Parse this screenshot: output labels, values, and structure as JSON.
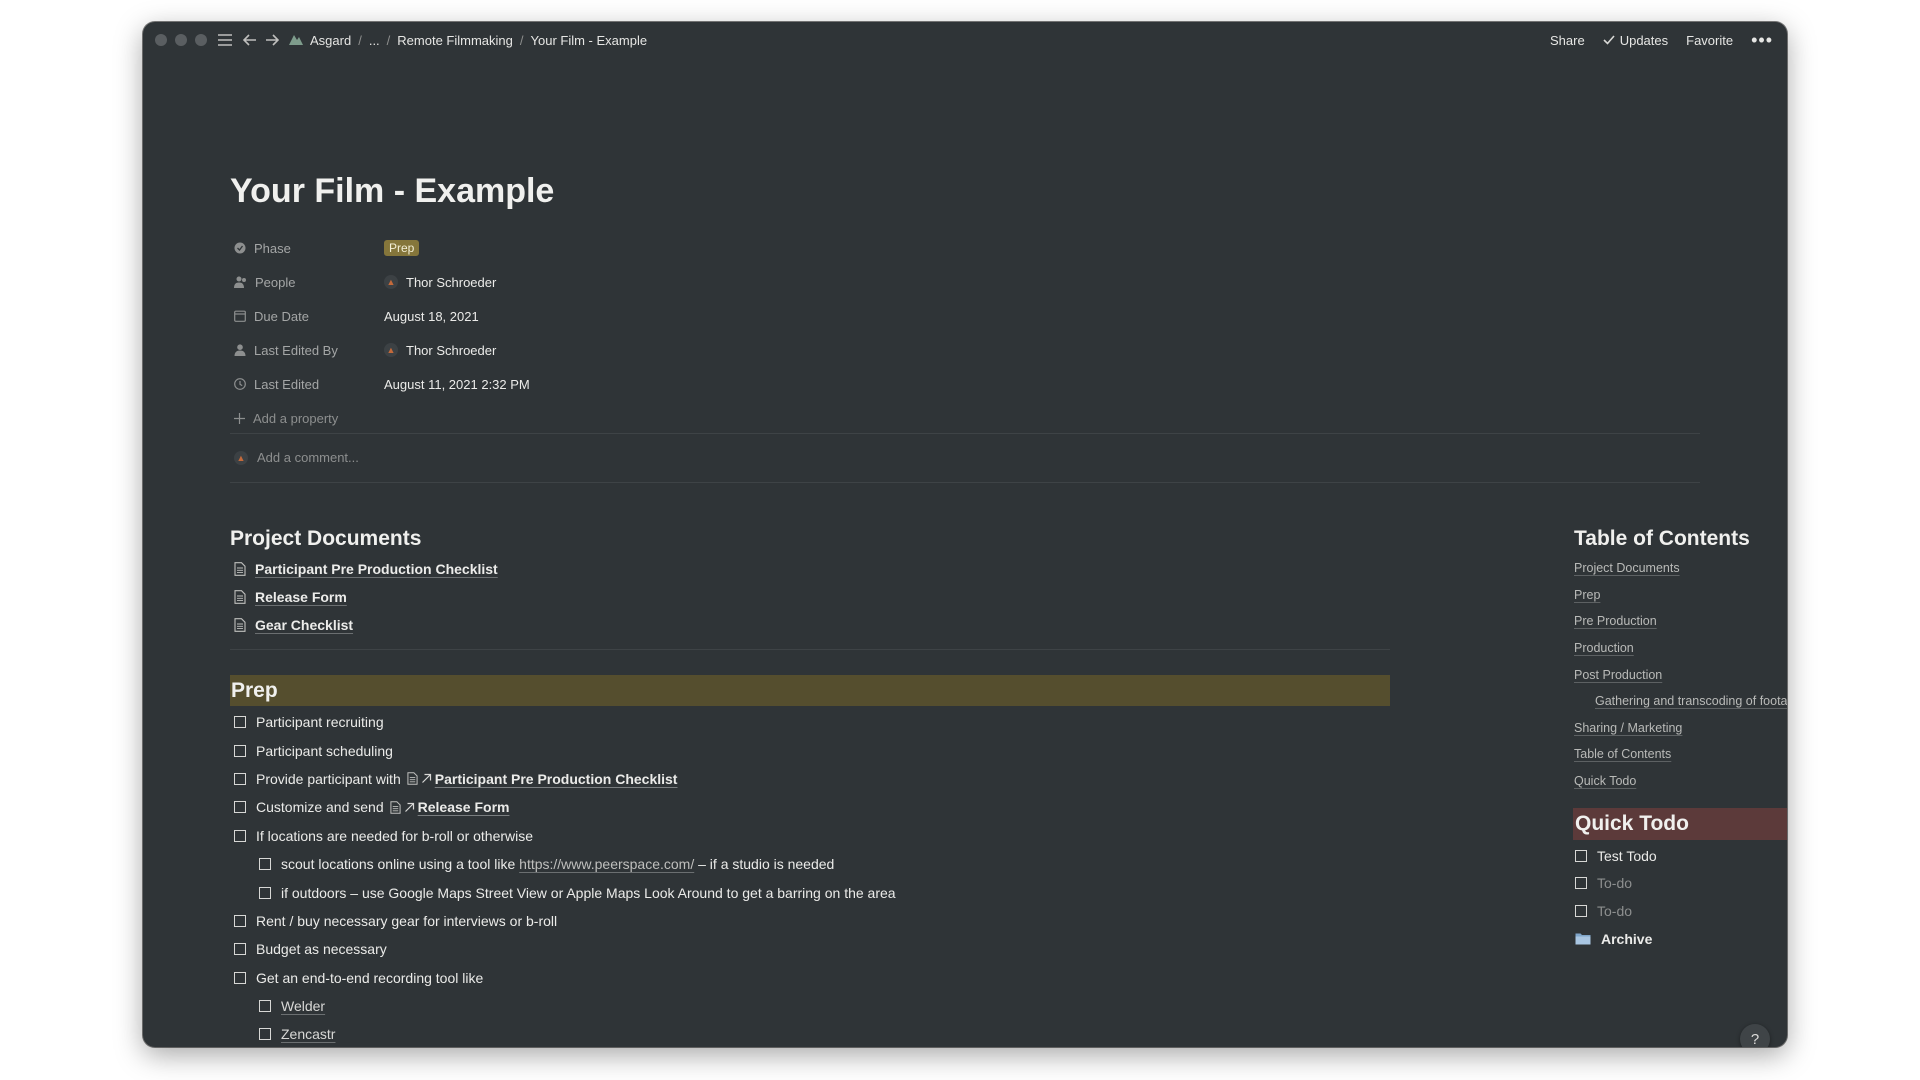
{
  "window": {
    "breadcrumb": [
      "Asgard",
      "...",
      "Remote Filmmaking",
      "Your Film - Example"
    ],
    "actions": {
      "share": "Share",
      "updates": "Updates",
      "favorite": "Favorite",
      "more": "•••"
    }
  },
  "page": {
    "title": "Your Film - Example",
    "properties": [
      {
        "name": "Phase",
        "value": "Prep",
        "icon": "status-icon",
        "type": "tag",
        "tag_color": "#85763b"
      },
      {
        "name": "People",
        "value": "Thor Schroeder",
        "icon": "people-icon",
        "type": "person"
      },
      {
        "name": "Due Date",
        "value": "August 18, 2021",
        "icon": "calendar-icon",
        "type": "text"
      },
      {
        "name": "Last Edited By",
        "value": "Thor Schroeder",
        "icon": "person-icon",
        "type": "person"
      },
      {
        "name": "Last Edited",
        "value": "August 11, 2021 2:32 PM",
        "icon": "clock-icon",
        "type": "text"
      }
    ],
    "add_property": "Add a property",
    "comment_placeholder": "Add a comment..."
  },
  "project_documents": {
    "heading": "Project Documents",
    "items": [
      "Participant Pre Production Checklist",
      "Release Form",
      "Gear Checklist"
    ]
  },
  "prep": {
    "heading": "Prep",
    "heading_bg": "#554e2e",
    "todos": {
      "t1": "Participant recruiting",
      "t2": "Participant scheduling",
      "t3_prefix": "Provide participant with",
      "t3_link": "Participant Pre Production Checklist",
      "t4_prefix": "Customize and send",
      "t4_link": "Release Form",
      "t5": "If locations are needed for b-roll or otherwise",
      "t5a_prefix": "scout locations online using a tool like",
      "t5a_url": "https://www.peerspace.com/",
      "t5a_suffix": "– if a studio is needed",
      "t5b": "if outdoors – use Google Maps Street View or Apple Maps Look Around to get a barring on the area",
      "t6": "Rent / buy necessary gear for interviews or b-roll",
      "t7": "Budget as necessary",
      "t8": "Get an end-to-end recording tool like",
      "t8a": "Welder",
      "t8b": "Zencastr"
    }
  },
  "toc": {
    "heading": "Table of Contents",
    "items": [
      "Project Documents",
      "Prep",
      "Pre Production",
      "Production",
      "Post Production",
      "Gathering and transcoding of footage an...",
      "Sharing / Marketing",
      "Table of Contents",
      "Quick Todo"
    ]
  },
  "quick_todo": {
    "heading": "Quick Todo",
    "heading_bg": "#5c3a3a",
    "items": [
      "Test Todo",
      "To-do",
      "To-do"
    ],
    "archive": "Archive"
  },
  "help": "?"
}
